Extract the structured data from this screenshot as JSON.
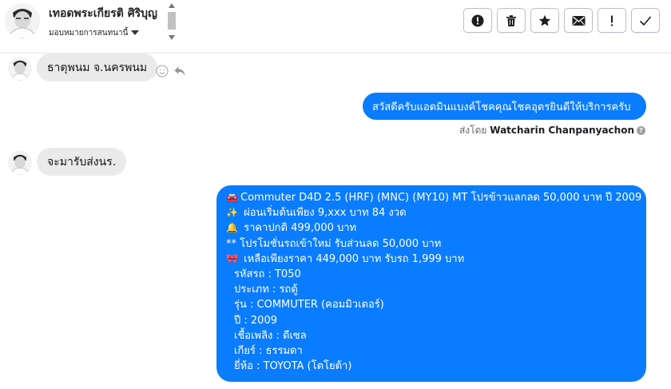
{
  "header": {
    "contact_name": "เทอดพระเกียรติ ศิริบุญ",
    "assign_label": "มอบหมายการสนทนานี้",
    "toolbar": [
      {
        "name": "report-button",
        "icon": "alert-circle-icon"
      },
      {
        "name": "delete-button",
        "icon": "trash-icon"
      },
      {
        "name": "star-button",
        "icon": "star-icon"
      },
      {
        "name": "mark-unread-button",
        "icon": "envelope-icon"
      },
      {
        "name": "important-button",
        "icon": "exclamation-icon"
      },
      {
        "name": "done-button",
        "icon": "check-icon"
      }
    ]
  },
  "messages": {
    "m1": "ธาตุพนม จ.นครพนม",
    "m2": "สวัสดีครับแอดมินแบงค์โชคคุณโชคอุตรยินดีให้บริการครับ",
    "sent_by_prefix": "ส่งโดย",
    "sent_by_name": "Watcharin Chanpanyachon",
    "m3": "จะมารับส่งนร.",
    "car": {
      "title": "Commuter D4D 2.5 (HRF) (MNC) (MY10) MT โปรข้าวแลกลด 50,000 บาท ปี 2009",
      "down": "ผ่อนเริ่มต้นเพียง 9,xxx บาท  84 งวด",
      "normal_price": "ราคาปกติ 499,000 บาท",
      "promo": "** โปรโมชั่นรถเข้าใหม่ รับส่วนลด 50,000 บาท",
      "final_price": "เหลือเพียงราคา 449,000 บาท รับรถ 1,999 บาท",
      "code": "รหัสรถ : T050",
      "type": "ประเภท : รถตู้",
      "model": "รุ่น : COMMUTER (คอมมิวเตอร์)",
      "year": "ปี : 2009",
      "fuel": "เชื้อเพลิง : ดีเซล",
      "gear": "เกียร์ : ธรรมดา",
      "brand": "ยี่ห้อ : TOYOTA (โตโยต้า)"
    }
  },
  "colors": {
    "outgoing": "#0a7cff",
    "incoming": "#eaeaea"
  }
}
